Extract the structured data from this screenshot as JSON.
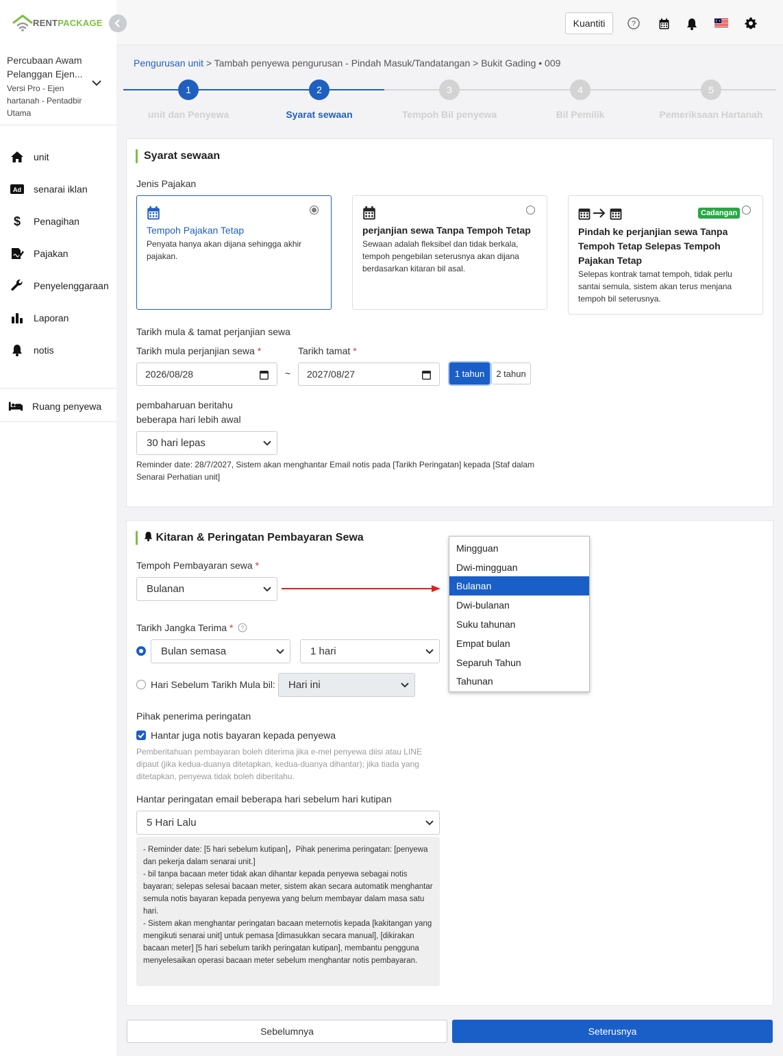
{
  "brand": {
    "part1": "RENT",
    "part2": "PACKAGE"
  },
  "account": {
    "name": "Percubaan Awam Pelanggan Ejen...",
    "role": "Versi Pro - Ejen hartanah - Pentadbir Utama"
  },
  "sidebar": {
    "items": [
      {
        "label": "unit",
        "icon": "home-icon"
      },
      {
        "label": "senarai iklan",
        "icon": "ad-icon"
      },
      {
        "label": "Penagihan",
        "icon": "dollar-icon"
      },
      {
        "label": "Pajakan",
        "icon": "contract-icon"
      },
      {
        "label": "Penyelenggaraan",
        "icon": "wrench-icon"
      },
      {
        "label": "Laporan",
        "icon": "bar-chart-icon"
      },
      {
        "label": "notis",
        "icon": "bell-icon"
      }
    ],
    "tenant_room": "Ruang penyewa"
  },
  "topbar": {
    "quantity_label": "Kuantiti"
  },
  "breadcrumb": {
    "link": "Pengurusan unit",
    "rest": " > Tambah penyewa pengurusan - Pindah Masuk/Tandatangan > Bukit Gading • 009"
  },
  "stepper": {
    "steps": [
      {
        "num": "1",
        "label": "unit dan Penyewa"
      },
      {
        "num": "2",
        "label": "Syarat sewaan"
      },
      {
        "num": "3",
        "label": "Tempoh Bil penyewa"
      },
      {
        "num": "4",
        "label": "Bil Pemilik"
      },
      {
        "num": "5",
        "label": "Pemeriksaan Hartanah"
      }
    ],
    "current": 2
  },
  "lease": {
    "title": "Syarat sewaan",
    "type_label": "Jenis Pajakan",
    "options": [
      {
        "title": "Tempoh Pajakan Tetap",
        "desc": "Penyata hanya akan dijana sehingga akhir pajakan.",
        "selected": true
      },
      {
        "title": "perjanjian sewa Tanpa Tempoh Tetap",
        "desc": "Sewaan adalah fleksibel dan tidak berkala, tempoh pengebilan seterusnya akan dijana berdasarkan kitaran bil asal.",
        "selected": false
      },
      {
        "title": "Pindah ke perjanjian sewa Tanpa Tempoh Tetap Selepas Tempoh Pajakan Tetap",
        "desc": "Selepas kontrak tamat tempoh, tidak perlu santai semula, sistem akan terus menjana tempoh bil seterusnya.",
        "badge": "Cadangan",
        "selected": false
      }
    ],
    "dates_heading": "Tarikh mula & tamat perjanjian sewa",
    "start_label": "Tarikh mula perjanjian sewa",
    "end_label": "Tarikh tamat",
    "start_value": "2026/08/28",
    "end_value": "2027/08/27",
    "tilde": "~",
    "year1": "1 tahun",
    "year2": "2 tahun",
    "renew_label_1": "pembaharuan beritahu",
    "renew_label_2": "beberapa hari lebih awal",
    "renew_value": "30 hari lepas",
    "reminder_note": "Reminder date: 28/7/2027, Sistem akan menghantar Email notis pada [Tarikh Peringatan] kepada [Staf dalam Senarai Perhatian unit]"
  },
  "payment": {
    "title": "Kitaran & Peringatan Pembayaran Sewa",
    "period_label": "Tempoh Pembayaran sewa",
    "period_value": "Bulanan",
    "due_label": "Tarikh Jangka Terima",
    "due_month": "Bulan semasa",
    "due_day": "1 hari",
    "before_label": "Hari Sebelum Tarikh Mula bil:",
    "before_value": "Hari ini",
    "recipients_label": "Pihak penerima peringatan",
    "notify_tenant": "Hantar juga notis bayaran kepada penyewa",
    "notify_note": "Pemberitahuan pembayaran boleh diterima jika e-mel penyewa diisi atau LINE dipaut (jika kedua-duanya ditetapkan, kedua-duanya dihantar); jika tiada yang ditetapkan, penyewa tidak boleh diberitahu.",
    "email_days_label": "Hantar peringatan email beberapa hari sebelum hari kutipan",
    "email_days_value": "5 Hari Lalu",
    "info_lines": [
      "- Reminder date: [5 hari sebelum kutipan]，Pihak penerima peringatan: [penyewa dan pekerja dalam senarai unit.]",
      "- bil tanpa bacaan meter tidak akan dihantar kepada penyewa sebagai notis bayaran; selepas selesai bacaan meter, sistem akan secara automatik menghantar semula notis bayaran kepada penyewa yang belum membayar dalam masa satu hari.",
      "- Sistem akan menghantar peringatan bacaan meternotis kepada [kakitangan yang mengikuti senarai unit] untuk pemasa [dimasukkan secara manual], [dikirakan bacaan meter] [5 hari sebelum tarikh peringatan kutipan], membantu pengguna menyelesaikan operasi bacaan meter sebelum menghantar notis pembayaran."
    ]
  },
  "period_dropdown": {
    "options": [
      "Mingguan",
      "Dwi-mingguan",
      "Bulanan",
      "Dwi-bulanan",
      "Suku tahunan",
      "Empat bulan",
      "Separuh Tahun",
      "Tahunan"
    ],
    "selected": "Bulanan"
  },
  "footer": {
    "prev": "Sebelumnya",
    "next": "Seterusnya"
  },
  "colors": {
    "accent": "#1a5ec8",
    "brand_green": "#7cc042",
    "required": "#d9303e",
    "arrow": "#e02020"
  }
}
